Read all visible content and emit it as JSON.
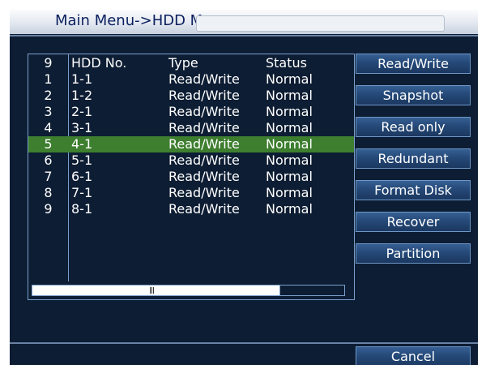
{
  "window": {
    "title": "Main Menu->HDD Manage",
    "colors": {
      "background": "#0d1d33",
      "selected_row": "#3d7e2f",
      "border": "#7b9fcc",
      "button": "#254978"
    }
  },
  "table": {
    "columns": {
      "index": "9",
      "hdd_no": "HDD No.",
      "type": "Type",
      "status": "Status"
    },
    "selected_index": 4,
    "rows": [
      {
        "idx": "1",
        "hdd": "1-1",
        "type": "Read/Write",
        "status": "Normal"
      },
      {
        "idx": "2",
        "hdd": "1-2",
        "type": "Read/Write",
        "status": "Normal"
      },
      {
        "idx": "3",
        "hdd": "2-1",
        "type": "Read/Write",
        "status": "Normal"
      },
      {
        "idx": "4",
        "hdd": "3-1",
        "type": "Read/Write",
        "status": "Normal"
      },
      {
        "idx": "5",
        "hdd": "4-1",
        "type": "Read/Write",
        "status": "Normal"
      },
      {
        "idx": "6",
        "hdd": "5-1",
        "type": "Read/Write",
        "status": "Normal"
      },
      {
        "idx": "7",
        "hdd": "6-1",
        "type": "Read/Write",
        "status": "Normal"
      },
      {
        "idx": "8",
        "hdd": "7-1",
        "type": "Read/Write",
        "status": "Normal"
      },
      {
        "idx": "9",
        "hdd": "8-1",
        "type": "Read/Write",
        "status": "Normal"
      }
    ]
  },
  "actions": [
    "Read/Write",
    "Snapshot",
    "Read only",
    "Redundant",
    "Format Disk",
    "Recover",
    "Partition"
  ],
  "footer": {
    "cancel_label": "Cancel"
  }
}
